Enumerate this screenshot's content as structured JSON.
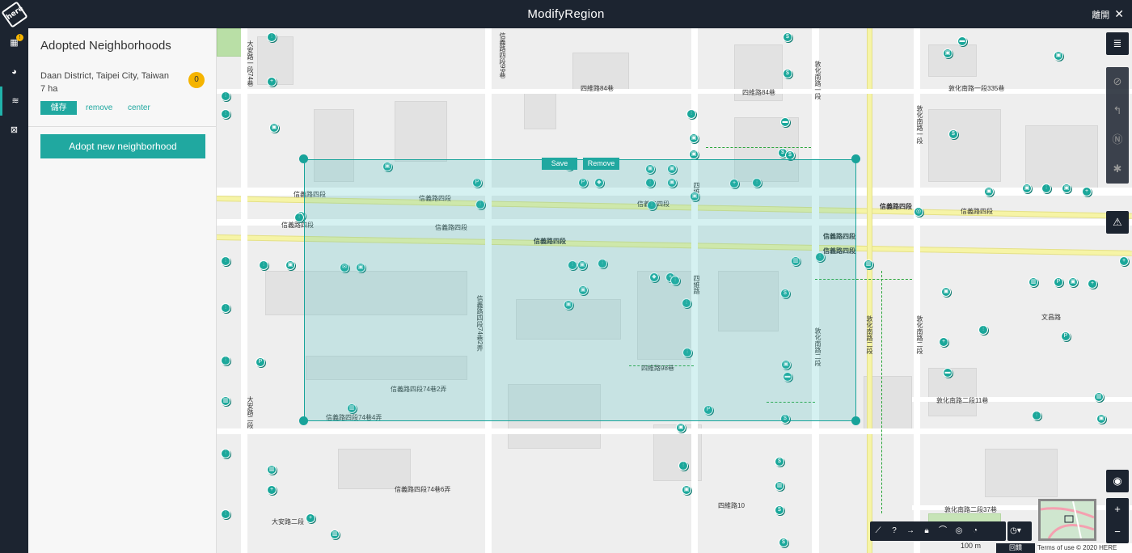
{
  "window": {
    "title": "ModifyRegion",
    "leave_label": "離開",
    "close_glyph": "✕",
    "logo_text": "here"
  },
  "rail": {
    "items": [
      {
        "name": "calendar-icon",
        "glyph": "▦",
        "badge": "!"
      },
      {
        "name": "pie-chart-icon",
        "glyph": "◕"
      },
      {
        "name": "neighborhood-icon",
        "glyph": "≋"
      },
      {
        "name": "image-icon",
        "glyph": "⊠"
      }
    ]
  },
  "panel": {
    "heading": "Adopted Neighborhoods",
    "neighborhood": {
      "name": "Daan District, Taipei City, Taiwan",
      "area": "7 ha",
      "count": "0"
    },
    "save_label": "儲存",
    "remove_label": "remove",
    "center_label": "center",
    "adopt_label": "Adopt new neighborhood"
  },
  "region": {
    "save_label": "Save",
    "remove_label": "Remove"
  },
  "map": {
    "road_labels": {
      "xinyi_upper": "信義路四段",
      "xinyi_lower": "信義路四段",
      "xinyi_east": "信義路四段",
      "lane_74_2": "信義路四段74巷2弄",
      "lane_74_4": "信義路四段74巷4弄",
      "lane_74_6": "信義路四段74巷6弄",
      "siwei_84": "四維路84巷",
      "siwei_98": "四維路98巷",
      "siwei_84_east": "四維路84巷",
      "siwei_10": "四維路10",
      "siwei": "四維路",
      "dunhua_n": "敦化南路一段",
      "dunhua_s": "敦化南路二段",
      "wenchang": "文昌路",
      "daan_2": "大安路二段",
      "dunhua_335": "敦化南路一段335巷",
      "dunhua_11": "敦化南路二段11巷",
      "dunhua_37": "敦化南路二段37巷",
      "daan_74": "大安路一段74巷",
      "xinyi_99": "信義路四段99巷"
    },
    "scale_label": "100 m",
    "feedback_label": "回饋",
    "terms_label": "Terms of use © 2020 HERE"
  },
  "controls": {
    "right_top": [
      "layers-icon"
    ],
    "right_mid": [
      "no-bike-icon",
      "no-left-turn-icon",
      "no-parking-icon",
      "settings-icon"
    ],
    "warning": "warning-icon",
    "locate": "locate-icon",
    "zoom_in": "+",
    "zoom_out": "−",
    "bottom": [
      "draw-line-icon",
      "help-icon",
      "arrow-icon",
      "lock-icon",
      "bridge-icon",
      "target-icon",
      "speed-icon",
      "clock-icon"
    ]
  },
  "colors": {
    "accent": "#20a8a0",
    "dark": "#1c2430",
    "badge": "#f5b400",
    "region_fill": "#40bebe"
  }
}
